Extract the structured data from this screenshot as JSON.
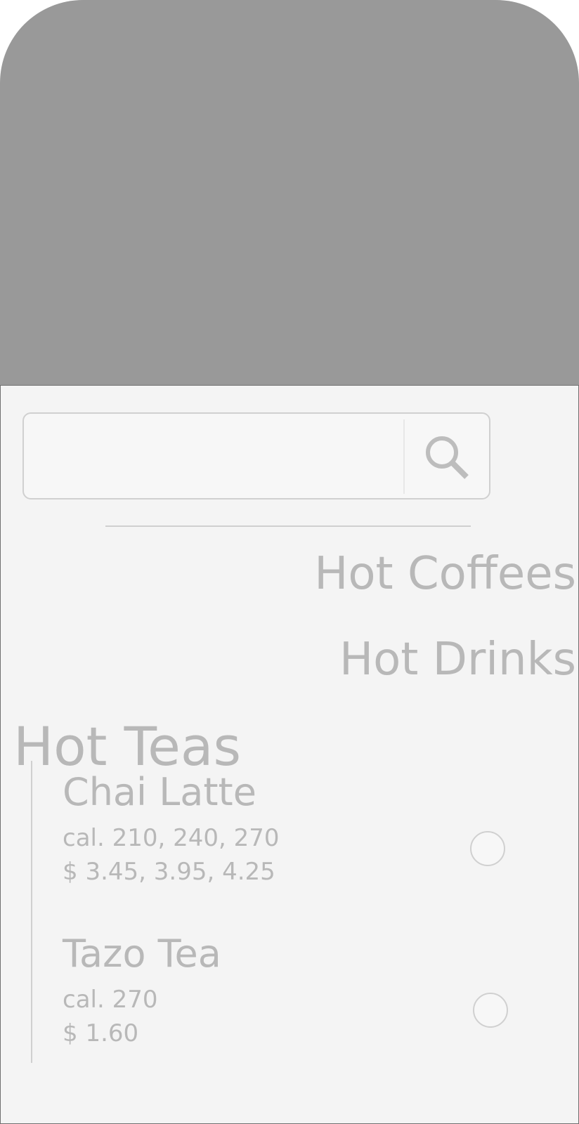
{
  "search": {
    "value": "",
    "placeholder": ""
  },
  "categories": [
    {
      "label": "Hot Coffees"
    },
    {
      "label": "Hot Drinks"
    },
    {
      "label": "Hot Teas"
    }
  ],
  "items": [
    {
      "name": "Chai Latte",
      "calories": "cal. 210, 240, 270",
      "price": "$ 3.45, 3.95, 4.25",
      "selected": false
    },
    {
      "name": "Tazo Tea",
      "calories": "cal. 270",
      "price": "$ 1.60",
      "selected": false
    }
  ],
  "colors": {
    "header": "#999999",
    "panel": "#f4f4f4",
    "text": "#b8b8b8",
    "border": "#d0d0d0"
  },
  "icons": {
    "search": "magnifier-icon"
  }
}
